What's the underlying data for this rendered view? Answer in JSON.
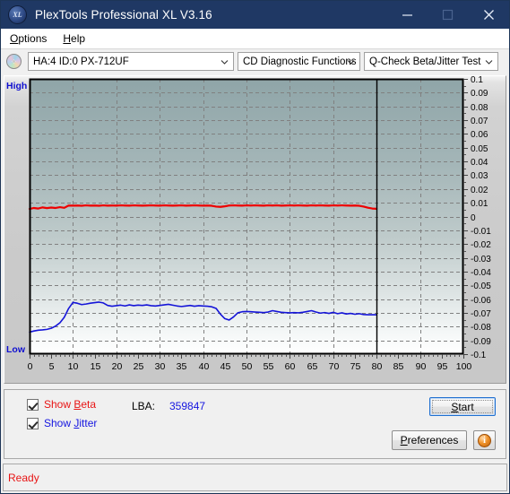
{
  "window": {
    "title": "PlexTools Professional XL V3.16",
    "logo_text": "XL",
    "minimize_label": "minimize",
    "maximize_label": "maximize",
    "close_label": "close"
  },
  "menubar": {
    "items": [
      {
        "label": "Options",
        "accel": "O"
      },
      {
        "label": "Help",
        "accel": "H"
      }
    ]
  },
  "toolbar": {
    "drive_select": {
      "value": "HA:4 ID:0  PX-712UF"
    },
    "function_select": {
      "value": "CD Diagnostic Functions"
    },
    "test_select": {
      "value": "Q-Check Beta/Jitter Test"
    }
  },
  "chart_labels": {
    "high": "High",
    "low": "Low"
  },
  "controls": {
    "show_beta": {
      "label_pre": "Show ",
      "label_accel": "B",
      "label_post": "eta",
      "checked": true
    },
    "show_jitter": {
      "label_pre": "Show ",
      "label_accel": "J",
      "label_post": "itter",
      "checked": true
    },
    "lba_label": "LBA:",
    "lba_value": "359847",
    "start_button": {
      "label_pre": "",
      "label_accel": "S",
      "label_post": "tart"
    },
    "preferences_button": {
      "label_pre": "",
      "label_accel": "P",
      "label_post": "references"
    },
    "info_button": {
      "label": "i"
    }
  },
  "statusbar": {
    "text": "Ready"
  },
  "chart_data": {
    "type": "line",
    "title": "Q-Check Beta/Jitter Test",
    "xlabel": "",
    "ylabel": "",
    "xlim": [
      0,
      100
    ],
    "ylim": [
      -0.1,
      0.1
    ],
    "xticks": [
      0,
      5,
      10,
      15,
      20,
      25,
      30,
      35,
      40,
      45,
      50,
      55,
      60,
      65,
      70,
      75,
      80,
      85,
      90,
      95,
      100
    ],
    "ytick_labels": [
      "0.1",
      "0.09",
      "0.08",
      "0.07",
      "0.06",
      "0.05",
      "0.04",
      "0.03",
      "0.02",
      "0.01",
      "0",
      "-0.01",
      "-0.02",
      "-0.03",
      "-0.04",
      "-0.05",
      "-0.06",
      "-0.07",
      "-0.08",
      "-0.09",
      "-0.1"
    ],
    "yticks": [
      0.1,
      0.09,
      0.08,
      0.07,
      0.06,
      0.05,
      0.04,
      0.03,
      0.02,
      0.01,
      0,
      -0.01,
      -0.02,
      -0.03,
      -0.04,
      -0.05,
      -0.06,
      -0.07,
      -0.08,
      -0.09,
      -0.1
    ],
    "grid": true,
    "grid_color": "#808080",
    "left_axis_label": "High",
    "bottom_axis_label": "Low",
    "plot_bg_top": "#8fa3a6",
    "plot_bg_bottom": "#ffffff",
    "data_end_marker_x": 80,
    "legend": [
      "Beta",
      "Jitter"
    ],
    "series": [
      {
        "name": "Beta",
        "color": "#ee0000",
        "x": [
          0,
          1,
          2,
          3,
          4,
          5,
          6,
          7,
          8,
          9,
          10,
          11,
          12,
          13,
          14,
          15,
          16,
          17,
          18,
          19,
          20,
          21,
          22,
          23,
          24,
          25,
          26,
          27,
          28,
          29,
          30,
          31,
          32,
          33,
          34,
          35,
          36,
          37,
          38,
          39,
          40,
          41,
          42,
          43,
          44,
          45,
          46,
          47,
          48,
          49,
          50,
          51,
          52,
          53,
          54,
          55,
          56,
          57,
          58,
          59,
          60,
          61,
          62,
          63,
          64,
          65,
          66,
          67,
          68,
          69,
          70,
          71,
          72,
          73,
          74,
          75,
          76,
          77,
          78,
          79,
          80
        ],
        "values": [
          0.0055,
          0.0062,
          0.0058,
          0.0066,
          0.0061,
          0.0065,
          0.0062,
          0.0068,
          0.0063,
          0.008,
          0.0079,
          0.008,
          0.0078,
          0.0081,
          0.0079,
          0.008,
          0.0078,
          0.0081,
          0.0079,
          0.008,
          0.0079,
          0.0081,
          0.008,
          0.0079,
          0.0081,
          0.008,
          0.0079,
          0.008,
          0.0081,
          0.008,
          0.0079,
          0.0081,
          0.008,
          0.0079,
          0.008,
          0.0081,
          0.0079,
          0.008,
          0.0081,
          0.008,
          0.0079,
          0.008,
          0.0078,
          0.0072,
          0.007,
          0.0074,
          0.008,
          0.0081,
          0.008,
          0.0079,
          0.0081,
          0.008,
          0.0081,
          0.008,
          0.0079,
          0.0081,
          0.008,
          0.0081,
          0.0079,
          0.008,
          0.0081,
          0.008,
          0.0081,
          0.008,
          0.0079,
          0.0081,
          0.008,
          0.0081,
          0.008,
          0.0079,
          0.0081,
          0.008,
          0.0081,
          0.008,
          0.0079,
          0.008,
          0.0078,
          0.0072,
          0.0064,
          0.0058,
          0.0056
        ]
      },
      {
        "name": "Jitter",
        "color": "#1515d8",
        "x": [
          0,
          1,
          2,
          3,
          4,
          5,
          6,
          7,
          8,
          9,
          10,
          11,
          12,
          13,
          14,
          15,
          16,
          17,
          18,
          19,
          20,
          21,
          22,
          23,
          24,
          25,
          26,
          27,
          28,
          29,
          30,
          31,
          32,
          33,
          34,
          35,
          36,
          37,
          38,
          39,
          40,
          41,
          42,
          43,
          44,
          45,
          46,
          47,
          48,
          49,
          50,
          51,
          52,
          53,
          54,
          55,
          56,
          57,
          58,
          59,
          60,
          61,
          62,
          63,
          64,
          65,
          66,
          67,
          68,
          69,
          70,
          71,
          72,
          73,
          74,
          75,
          76,
          77,
          78,
          79,
          80
        ],
        "values": [
          -0.084,
          -0.0832,
          -0.0826,
          -0.0824,
          -0.082,
          -0.0812,
          -0.0796,
          -0.0772,
          -0.0732,
          -0.0668,
          -0.0624,
          -0.063,
          -0.064,
          -0.0636,
          -0.063,
          -0.0626,
          -0.0622,
          -0.0628,
          -0.0646,
          -0.0652,
          -0.0648,
          -0.0644,
          -0.065,
          -0.0642,
          -0.0648,
          -0.0644,
          -0.0646,
          -0.0642,
          -0.0648,
          -0.065,
          -0.0646,
          -0.0642,
          -0.0638,
          -0.0644,
          -0.065,
          -0.0654,
          -0.065,
          -0.0646,
          -0.0652,
          -0.0648,
          -0.065,
          -0.0652,
          -0.0656,
          -0.0668,
          -0.071,
          -0.0742,
          -0.0752,
          -0.073,
          -0.07,
          -0.0692,
          -0.069,
          -0.0692,
          -0.0694,
          -0.0696,
          -0.0698,
          -0.0694,
          -0.0684,
          -0.069,
          -0.0696,
          -0.0698,
          -0.07,
          -0.0698,
          -0.07,
          -0.0696,
          -0.069,
          -0.0684,
          -0.0694,
          -0.0702,
          -0.0698,
          -0.0704,
          -0.0696,
          -0.0706,
          -0.07,
          -0.0708,
          -0.0704,
          -0.071,
          -0.0706,
          -0.0712,
          -0.0714,
          -0.0714,
          -0.0714
        ]
      }
    ]
  }
}
